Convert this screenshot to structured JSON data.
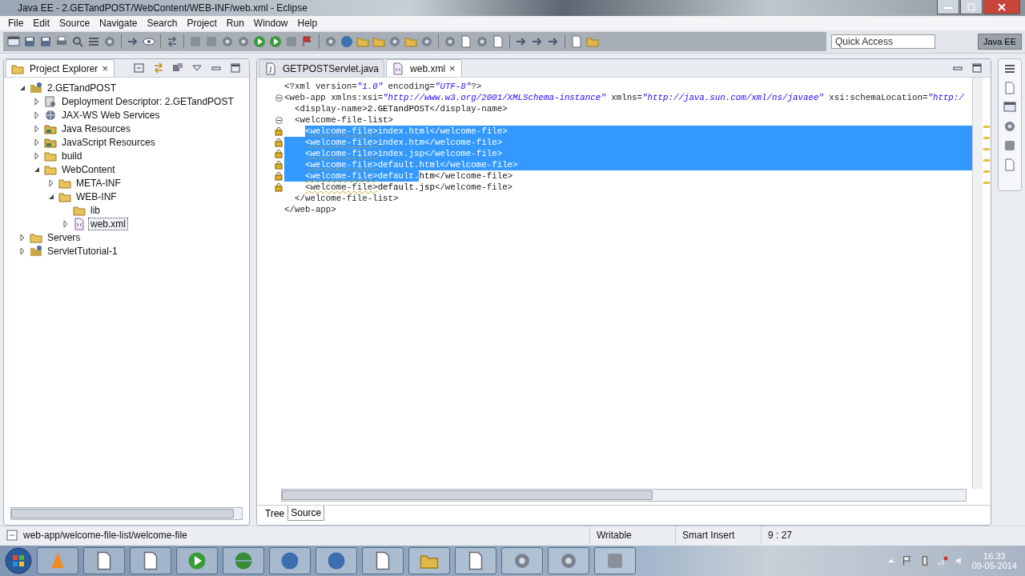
{
  "window": {
    "title": "Java EE - 2.GETandPOST/WebContent/WEB-INF/web.xml - Eclipse"
  },
  "menu": [
    "File",
    "Edit",
    "Source",
    "Navigate",
    "Search",
    "Project",
    "Run",
    "Window",
    "Help"
  ],
  "quick_access": {
    "placeholder": "Quick Access"
  },
  "perspective": {
    "label": "Java EE",
    "selected": true
  },
  "project_explorer": {
    "title": "Project Explorer",
    "close": "×",
    "tree": [
      {
        "label": "2.GETandPOST",
        "kind": "project",
        "expandable": true,
        "expanded": true,
        "selected": false,
        "children": [
          {
            "label": "Deployment Descriptor: 2.GETandPOST",
            "kind": "descriptor",
            "expandable": true,
            "expanded": false,
            "selected": false
          },
          {
            "label": "JAX-WS Web Services",
            "kind": "services",
            "expandable": true,
            "expanded": false,
            "selected": false
          },
          {
            "label": "Java Resources",
            "kind": "resources",
            "expandable": true,
            "expanded": false,
            "selected": false
          },
          {
            "label": "JavaScript Resources",
            "kind": "resources",
            "expandable": true,
            "expanded": false,
            "selected": false
          },
          {
            "label": "build",
            "kind": "folder",
            "expandable": true,
            "expanded": false,
            "selected": false
          },
          {
            "label": "WebContent",
            "kind": "folder",
            "expandable": true,
            "expanded": true,
            "selected": false,
            "children": [
              {
                "label": "META-INF",
                "kind": "folder",
                "expandable": true,
                "expanded": false,
                "selected": false
              },
              {
                "label": "WEB-INF",
                "kind": "folder",
                "expandable": true,
                "expanded": true,
                "selected": false,
                "children": [
                  {
                    "label": "lib",
                    "kind": "folder",
                    "expandable": false,
                    "selected": false
                  },
                  {
                    "label": "web.xml",
                    "kind": "xml",
                    "expandable": true,
                    "expanded": false,
                    "selected": true
                  }
                ]
              }
            ]
          }
        ]
      },
      {
        "label": "Servers",
        "kind": "folder",
        "expandable": true,
        "expanded": false,
        "selected": false
      },
      {
        "label": "ServletTutorial-1",
        "kind": "project",
        "expandable": true,
        "expanded": false,
        "selected": false
      }
    ]
  },
  "editor": {
    "tabs": [
      {
        "label": "GETPOSTServlet.java",
        "kind": "java",
        "selected": false
      },
      {
        "label": "web.xml",
        "kind": "xml",
        "selected": true,
        "close": "×"
      }
    ],
    "lines": [
      {
        "fold_marker": false,
        "warning": false,
        "eol_selected": false,
        "segments": [
          {
            "kind": "markup",
            "text": "<?xml version=",
            "selected": false
          },
          {
            "kind": "value",
            "text": "\"1.0\"",
            "selected": false
          },
          {
            "kind": "markup",
            "text": " encoding=",
            "selected": false
          },
          {
            "kind": "value",
            "text": "\"UTF-8\"",
            "selected": false
          },
          {
            "kind": "markup",
            "text": "?>",
            "selected": false
          }
        ]
      },
      {
        "fold_marker": true,
        "warning": false,
        "eol_selected": false,
        "segments": [
          {
            "kind": "markup",
            "text": "<web-app xmlns:xsi=",
            "selected": false
          },
          {
            "kind": "value",
            "text": "\"http://www.w3.org/2001/XMLSchema-instance\"",
            "selected": false
          },
          {
            "kind": "markup",
            "text": " xmlns=",
            "selected": false
          },
          {
            "kind": "value",
            "text": "\"http://java.sun.com/xml/ns/javaee\"",
            "selected": false
          },
          {
            "kind": "markup",
            "text": " xsi:schemaLocation=",
            "selected": false
          },
          {
            "kind": "value",
            "text": "\"http:/",
            "selected": false
          }
        ]
      },
      {
        "fold_marker": false,
        "warning": false,
        "eol_selected": false,
        "segments": [
          {
            "kind": "markup",
            "text": "  <display-name>",
            "selected": false
          },
          {
            "kind": "text",
            "text": "2.GETandPOST",
            "selected": false
          },
          {
            "kind": "markup",
            "text": "</display-name>",
            "selected": false
          }
        ]
      },
      {
        "fold_marker": true,
        "warning": false,
        "eol_selected": false,
        "segments": [
          {
            "kind": "markup",
            "text": "  <welcome-file-list>",
            "selected": false
          }
        ]
      },
      {
        "fold_marker": false,
        "warning": true,
        "eol_selected": true,
        "indent_selected": false,
        "segments": [
          {
            "kind": "flagged",
            "text": "<welcome-file>",
            "selected": true
          },
          {
            "kind": "text",
            "text": "index.html",
            "selected": true
          },
          {
            "kind": "markup",
            "text": "</welcome-file>",
            "selected": true
          }
        ]
      },
      {
        "fold_marker": false,
        "warning": true,
        "eol_selected": true,
        "indent_selected": true,
        "segments": [
          {
            "kind": "flagged",
            "text": "<welcome-file>",
            "selected": true
          },
          {
            "kind": "text",
            "text": "index.htm",
            "selected": true
          },
          {
            "kind": "markup",
            "text": "</welcome-file>",
            "selected": true
          }
        ]
      },
      {
        "fold_marker": false,
        "warning": true,
        "eol_selected": true,
        "indent_selected": true,
        "segments": [
          {
            "kind": "flagged",
            "text": "<welcome-file>",
            "selected": true
          },
          {
            "kind": "text",
            "text": "index.jsp",
            "selected": true
          },
          {
            "kind": "markup",
            "text": "</welcome-file>",
            "selected": true
          }
        ]
      },
      {
        "fold_marker": false,
        "warning": true,
        "eol_selected": true,
        "indent_selected": true,
        "segments": [
          {
            "kind": "flagged",
            "text": "<welcome-file>",
            "selected": true
          },
          {
            "kind": "text",
            "text": "default.html",
            "selected": true
          },
          {
            "kind": "markup",
            "text": "</welcome-file>",
            "selected": true
          }
        ]
      },
      {
        "fold_marker": false,
        "warning": true,
        "eol_selected": false,
        "indent_selected": true,
        "segments": [
          {
            "kind": "flagged",
            "text": "<welcome-file>",
            "selected": true
          },
          {
            "kind": "text",
            "text": "default.",
            "selected": true
          },
          {
            "kind": "text",
            "text": "htm",
            "selected": false
          },
          {
            "kind": "markup",
            "text": "</welcome-file>",
            "selected": false
          }
        ]
      },
      {
        "fold_marker": false,
        "warning": true,
        "eol_selected": false,
        "indent_selected": false,
        "segments": [
          {
            "kind": "flagged",
            "text": "<welcome-file>",
            "selected": false
          },
          {
            "kind": "text",
            "text": "default.jsp",
            "selected": false
          },
          {
            "kind": "markup",
            "text": "</welcome-file>",
            "selected": false
          }
        ]
      },
      {
        "fold_marker": false,
        "warning": false,
        "eol_selected": false,
        "segments": [
          {
            "kind": "markup",
            "text": "  </welcome-file-list>",
            "selected": false
          }
        ]
      },
      {
        "fold_marker": false,
        "warning": false,
        "eol_selected": false,
        "segments": [
          {
            "kind": "markup",
            "text": "</web-app>",
            "selected": false
          }
        ]
      }
    ],
    "bottom_tabs": [
      {
        "label": "Tree",
        "selected": false
      },
      {
        "label": "Source",
        "selected": true
      }
    ]
  },
  "status_bar": {
    "path": "web-app/welcome-file-list/welcome-file",
    "mode": "Writable",
    "insert": "Smart Insert",
    "position": "9 : 27"
  },
  "taskbar": {
    "time": "16:33",
    "date": "09-05-2014"
  }
}
